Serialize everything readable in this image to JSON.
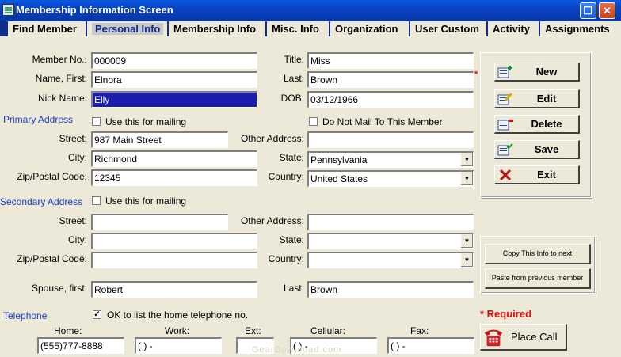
{
  "window": {
    "title": "Membership Information Screen"
  },
  "tabs": [
    "Find Member",
    "Personal Info",
    "Membership Info",
    "Misc. Info",
    "Organization",
    "User Custom",
    "Activity",
    "Assignments"
  ],
  "member": {
    "member_no_label": "Member No.:",
    "member_no": "000009",
    "title_label": "Title:",
    "title": "Miss",
    "first_label": "Name, First:",
    "first": "Elnora",
    "last_label": "Last:",
    "last": "Brown",
    "nick_label": "Nick Name:",
    "nick": "Elly",
    "dob_label": "DOB:",
    "dob": "03/12/1966"
  },
  "primary": {
    "heading": "Primary Address",
    "use_mailing_label": "Use this for mailing",
    "do_not_mail_label": "Do Not Mail To This Member",
    "street_label": "Street:",
    "street": "987 Main Street",
    "other_label": "Other Address:",
    "other": "",
    "city_label": "City:",
    "city": "Richmond",
    "state_label": "State:",
    "state": "Pennsylvania",
    "zip_label": "Zip/Postal Code:",
    "zip": "12345",
    "country_label": "Country:",
    "country": "United States"
  },
  "secondary": {
    "heading": "Secondary Address",
    "use_mailing_label": "Use this for mailing",
    "street_label": "Street:",
    "other_label": "Other Address:",
    "city_label": "City:",
    "state_label": "State:",
    "zip_label": "Zip/Postal Code:",
    "country_label": "Country:"
  },
  "spouse": {
    "first_label": "Spouse, first:",
    "first": "Robert",
    "last_label": "Last:",
    "last": "Brown"
  },
  "telephone": {
    "heading": "Telephone",
    "ok_label": "OK to list the home telephone no.",
    "home_label": "Home:",
    "home": "(555)777-8888",
    "work_label": "Work:",
    "work": "(    )      -",
    "ext_label": "Ext:",
    "ext": "",
    "cell_label": "Cellular:",
    "cell": "(    )      -",
    "fax_label": "Fax:",
    "fax": "(    )      -"
  },
  "actions": {
    "new": "New",
    "edit": "Edit",
    "delete": "Delete",
    "save": "Save",
    "exit": "Exit"
  },
  "copy_buttons": {
    "copy_next": "Copy This Info to next",
    "paste_prev": "Paste from previous member"
  },
  "required": {
    "star": "*",
    "label": "* Required"
  },
  "place_call": "Place Call",
  "watermark": "GearDownload.com",
  "colors": {
    "title_bar": "#0843c4",
    "tab_bar": "#0f2d8a",
    "section_heading": "#1a3cc8",
    "required": "#e01010",
    "selection": "#1b1bb0"
  }
}
